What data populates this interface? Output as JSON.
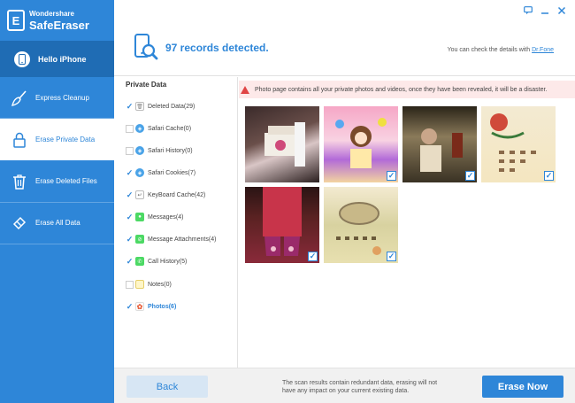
{
  "app": {
    "brand": "Wondershare",
    "name": "SafeEraser"
  },
  "sidebar": {
    "items": [
      {
        "label": "Hello iPhone"
      },
      {
        "label": "Express Cleanup"
      },
      {
        "label": "Erase Private Data"
      },
      {
        "label": "Erase Deleted Files"
      },
      {
        "label": "Erase All Data"
      }
    ]
  },
  "header": {
    "title": "97 records detected.",
    "hint": "You can check the details with ",
    "hint_link": "Dr.Fone"
  },
  "categories": {
    "title": "Private Data",
    "items": [
      {
        "label": "Deleted Data(29)",
        "checked": true
      },
      {
        "label": "Safari Cache(0)",
        "checked": false
      },
      {
        "label": "Safari History(0)",
        "checked": false
      },
      {
        "label": "Safari Cookies(7)",
        "checked": true
      },
      {
        "label": "KeyBoard Cache(42)",
        "checked": true
      },
      {
        "label": "Messages(4)",
        "checked": true
      },
      {
        "label": "Message Attachments(4)",
        "checked": true
      },
      {
        "label": "Call History(5)",
        "checked": true
      },
      {
        "label": "Notes(0)",
        "checked": false
      },
      {
        "label": "Photos(6)",
        "checked": true
      }
    ]
  },
  "content": {
    "warning": "Photo page contains all your private photos and videos, once they have been revealed, it will be a disaster."
  },
  "footer": {
    "back_label": "Back",
    "note": "The scan results contain redundant data, erasing will not have any impact on your current existing data.",
    "erase_label": "Erase Now"
  },
  "colors": {
    "accent": "#2e86d8",
    "sidebar": "#2e86d8",
    "warning_bg": "#fde9e9"
  }
}
